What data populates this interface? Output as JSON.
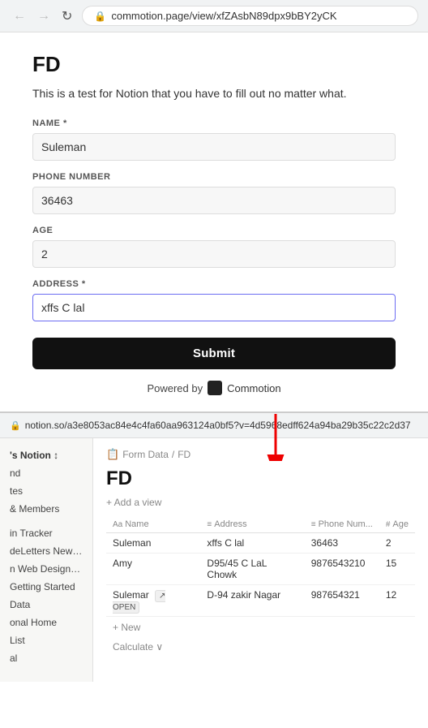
{
  "browser": {
    "url": "commotion.page/view/xfZAsbN89dpx9bBY2yCK",
    "back_icon": "←",
    "forward_icon": "→",
    "reload_icon": "↻",
    "lock_icon": "🔒"
  },
  "form": {
    "title": "FD",
    "description": "This is a test for Notion that you have to fill out no matter what.",
    "fields": [
      {
        "label": "NAME",
        "required": true,
        "value": "Suleman",
        "active": false
      },
      {
        "label": "PHONE NUMBER",
        "required": false,
        "value": "36463",
        "active": false
      },
      {
        "label": "AGE",
        "required": false,
        "value": "2",
        "active": false
      },
      {
        "label": "ADDRESS",
        "required": true,
        "value": "xffs C lal",
        "active": true
      }
    ],
    "submit_label": "Submit",
    "powered_by_text": "Powered by",
    "commotion_text": "Commotion"
  },
  "notion_bar": {
    "url": "notion.so/a3e8053ac84e4c4fa60aa963124a0bf5?v=4d5968edff624a94ba29b35c22c2d37"
  },
  "notion": {
    "sidebar_items": [
      {
        "label": "'s Notion ↕",
        "bold": true
      },
      {
        "label": "nd"
      },
      {
        "label": "tes"
      },
      {
        "label": "& Members"
      },
      {
        "label": ""
      },
      {
        "label": "in Tracker"
      },
      {
        "label": "deLetters Newslet..."
      },
      {
        "label": "n Web Designer Hub"
      },
      {
        "label": "Getting Started"
      },
      {
        "label": "Data"
      },
      {
        "label": "onal Home"
      },
      {
        "label": "List"
      },
      {
        "label": "al"
      }
    ],
    "breadcrumb": {
      "db_icon": "📋",
      "parts": [
        "Form Data",
        "/",
        "FD"
      ]
    },
    "page_title": "FD",
    "add_view": "+ Add a view",
    "table_headers": [
      {
        "icon": "Aa",
        "label": "Name"
      },
      {
        "icon": "≡",
        "label": "Address"
      },
      {
        "icon": "≡",
        "label": "Phone Num..."
      },
      {
        "icon": "#",
        "label": "Age"
      }
    ],
    "table_rows": [
      {
        "name": "Suleman",
        "address": "xffs C lal",
        "phone": "36463",
        "age": "2",
        "open": false
      },
      {
        "name": "Amy",
        "address": "D95/45 C LaL Chowk",
        "phone": "9876543210",
        "age": "15",
        "open": false
      },
      {
        "name": "Sulemar",
        "address": "D-94 zakir Nagar",
        "phone": "987654321",
        "age": "12",
        "open": true
      }
    ],
    "new_row_label": "+ New",
    "calculate_label": "Calculate ∨"
  }
}
